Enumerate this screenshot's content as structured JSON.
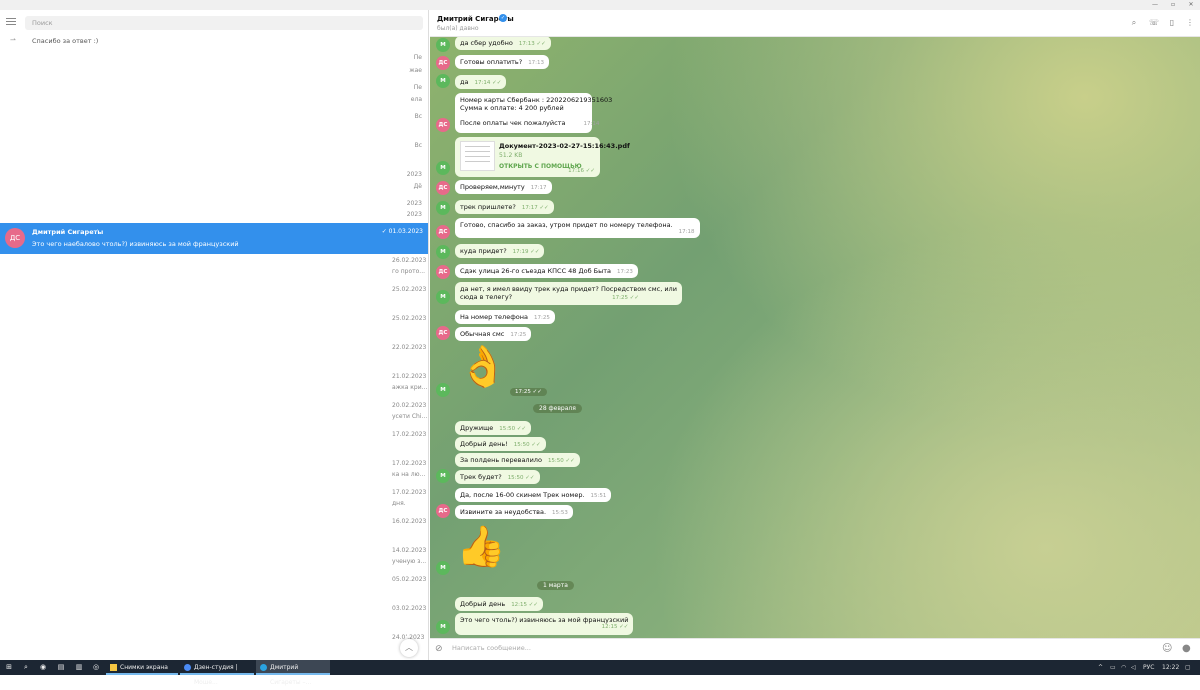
{
  "search": {
    "placeholder": "Поиск"
  },
  "left_list": {
    "pinned_snippet": "Спасибо за ответ :)",
    "selected": {
      "avatar": "ДС",
      "name": "Дмитрий Сигареты",
      "date": "01.03.2023",
      "message": "Это чего наебалово чтоль?) извиняюсь за мой французский"
    },
    "right_fragments": [
      {
        "text": "Пе"
      },
      {
        "text": "жае"
      },
      {
        "text": "Пе"
      },
      {
        "text": "ела"
      },
      {
        "text": "Вс"
      },
      {
        "text": "Вс"
      },
      {
        "text": "2023"
      },
      {
        "text": "Дё"
      },
      {
        "text": "2023"
      },
      {
        "text": "2023"
      }
    ],
    "lower_fragments": [
      {
        "date": "26.02.2023",
        "text": "го прото..."
      },
      {
        "date": "25.02.2023",
        "text": ""
      },
      {
        "date": "25.02.2023",
        "text": ""
      },
      {
        "date": "22.02.2023",
        "text": ""
      },
      {
        "date": "21.02.2023",
        "text": "ажка кри..."
      },
      {
        "date": "20.02.2023",
        "text": "усети Chi..."
      },
      {
        "date": "17.02.2023",
        "text": ""
      },
      {
        "date": "17.02.2023",
        "text": "ка на лю..."
      },
      {
        "date": "17.02.2023",
        "text": "дня."
      },
      {
        "date": "16.02.2023",
        "text": ""
      },
      {
        "date": "14.02.2023",
        "text": "ученую з..."
      },
      {
        "date": "05.02.2023",
        "text": ""
      },
      {
        "date": "03.02.2023",
        "text": ""
      },
      {
        "date": "24.0’.2023",
        "text": ""
      }
    ]
  },
  "header": {
    "name": "Дмитрий Сигареты",
    "status": "был(а) давно"
  },
  "messages": [
    {
      "from": "М",
      "text": "да сбер удобно",
      "time": "17:13",
      "out": true
    },
    {
      "from": "ДС",
      "text": "Готовы оплатить?",
      "time": "17:13",
      "out": false
    },
    {
      "from": "М",
      "text": "да",
      "time": "17:14",
      "out": true
    },
    {
      "from": "ДС",
      "lines": [
        "Номер карты Сбербанк : 2202206219351603",
        "Сумма к оплате: 4 200 рублей",
        "",
        "После оплаты чек пожалуйста"
      ],
      "time": "17:14",
      "out": false
    },
    {
      "from": "М",
      "type": "document",
      "name": "Документ-2023-02-27-15:16:43.pdf",
      "size": "51.2 KB",
      "action": "ОТКРЫТЬ С ПОМОЩЬЮ",
      "time": "17:16",
      "out": true
    },
    {
      "from": "ДС",
      "text": "Проверяем,минуту",
      "time": "17:17",
      "out": false
    },
    {
      "from": "М",
      "text": "трек пришлете?",
      "time": "17:17",
      "out": true
    },
    {
      "from": "ДС",
      "text": "Готово, спасибо за заказ, утром придет по номеру телефона.",
      "time": "17:18",
      "out": false
    },
    {
      "from": "М",
      "text": "куда придет?",
      "time": "17:19",
      "out": true
    },
    {
      "from": "ДС",
      "text": "Сдэк улица 26-го съезда КПСС 48 Доб Быта",
      "time": "17:23",
      "out": false
    },
    {
      "from": "М",
      "lines": [
        "да нет, я имел ввиду трек куда придет? Посредством смс, или",
        "сюда в телегу?"
      ],
      "time": "17:25",
      "out": true
    },
    {
      "from": "ДС",
      "text": "На номер телефона",
      "time": "17:25",
      "out": false
    },
    {
      "from": "ДС",
      "text": "Обычная смс",
      "time": "17:25",
      "out": false
    },
    {
      "from": "М",
      "type": "sticker",
      "emoji": "👌",
      "time": "17:25",
      "out": true
    },
    {
      "type": "date",
      "text": "28 февраля"
    },
    {
      "from": "М",
      "text": "Дружище",
      "time": "15:50",
      "out": true
    },
    {
      "from": "М",
      "text": "Добрый день!",
      "time": "15:50",
      "out": true
    },
    {
      "from": "М",
      "text": "За полдень перевалило",
      "time": "15:50",
      "out": true
    },
    {
      "from": "М",
      "text": "Трек будет?",
      "time": "15:50",
      "out": true
    },
    {
      "from": "ДС",
      "text": "Да, после 16-00 скинем Трек номер.",
      "time": "15:51",
      "out": false
    },
    {
      "from": "ДС",
      "text": "Извините за неудобства.",
      "time": "15:53",
      "out": false
    },
    {
      "from": "М",
      "type": "sticker",
      "emoji": "👍",
      "out": true
    },
    {
      "type": "date",
      "text": "1 марта"
    },
    {
      "from": "М",
      "text": "Добрый день",
      "time": "12:15",
      "out": true
    },
    {
      "from": "М",
      "text": "Это чего                       чтоль?) извиняюсь за мой французский",
      "time": "12:15",
      "out": true
    }
  ],
  "composer": {
    "placeholder": "Написать сообщение..."
  },
  "taskbar": {
    "apps": [
      {
        "label": "Снимки экрана"
      },
      {
        "label": "Дзен-студия | Моше..."
      },
      {
        "label": "Дмитрий Сигареты –..."
      }
    ],
    "lang": "РУС",
    "time": "12:22"
  }
}
